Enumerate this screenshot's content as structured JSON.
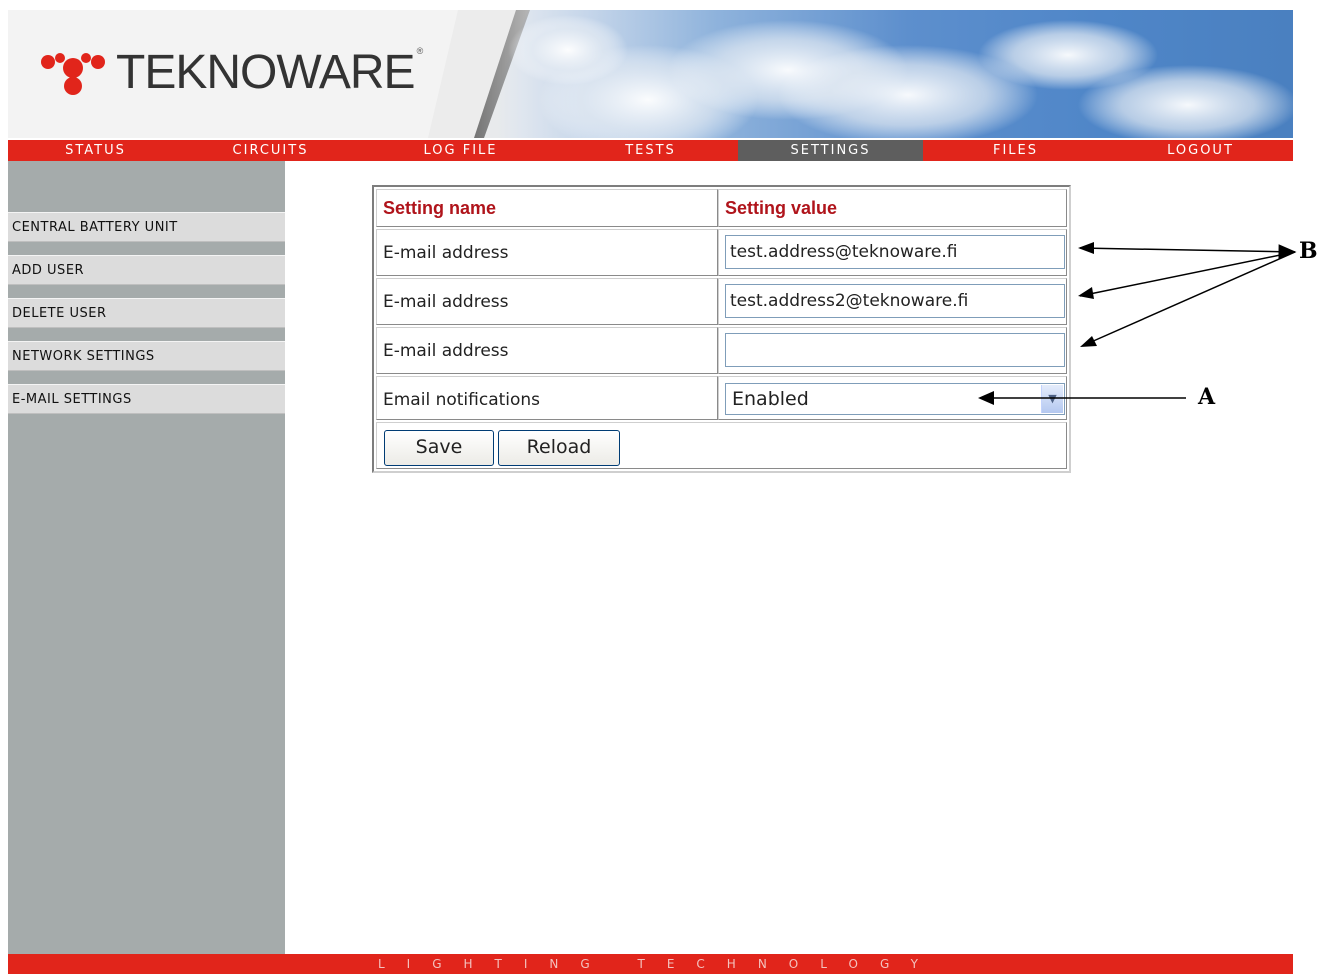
{
  "brand": {
    "logo_text": "TEKNOWARE",
    "registered_mark": "®"
  },
  "nav": {
    "items": [
      {
        "label": "STATUS"
      },
      {
        "label": "CIRCUITS"
      },
      {
        "label": "LOG FILE"
      },
      {
        "label": "TESTS"
      },
      {
        "label": "SETTINGS",
        "active": true
      },
      {
        "label": "FILES"
      },
      {
        "label": "LOGOUT"
      }
    ]
  },
  "sidebar": {
    "items": [
      {
        "label": "CENTRAL BATTERY UNIT"
      },
      {
        "label": "ADD USER"
      },
      {
        "label": "DELETE USER"
      },
      {
        "label": "NETWORK SETTINGS"
      },
      {
        "label": "E-MAIL SETTINGS"
      }
    ]
  },
  "table": {
    "col_name_header": "Setting name",
    "col_value_header": "Setting value",
    "rows": [
      {
        "name": "E-mail address",
        "value": "test.address@teknoware.fi"
      },
      {
        "name": "E-mail address",
        "value": "test.address2@teknoware.fi"
      },
      {
        "name": "E-mail address",
        "value": ""
      },
      {
        "name": "Email notifications",
        "value": "Enabled"
      }
    ],
    "save_label": "Save",
    "reload_label": "Reload"
  },
  "footer": {
    "tagline": "LIGHTING TECHNOLOGY"
  },
  "annotations": {
    "label_a": "A",
    "label_b": "B"
  },
  "colors": {
    "brand_red": "#e1251b",
    "active_tab": "#5e5e5e",
    "sidebar_bg": "#a5abab",
    "header_text_red": "#b0141b"
  }
}
